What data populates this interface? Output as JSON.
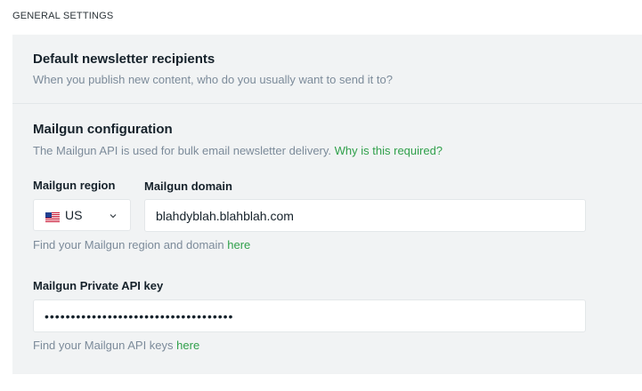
{
  "section": {
    "title": "GENERAL SETTINGS"
  },
  "newsletter": {
    "title": "Default newsletter recipients",
    "description": "When you publish new content, who do you usually want to send it to?"
  },
  "mailgun": {
    "title": "Mailgun configuration",
    "description": "The Mailgun API is used for bulk email newsletter delivery.",
    "why_link": "Why is this required?",
    "region": {
      "label": "Mailgun region",
      "value": "US",
      "flag_icon": "us-flag-icon"
    },
    "domain": {
      "label": "Mailgun domain",
      "value": "blahdyblah.blahblah.com"
    },
    "domain_hint": {
      "text": "Find your Mailgun region and domain",
      "link": "here"
    },
    "api_key": {
      "label": "Mailgun Private API key",
      "value": "••••••••••••••••••••••••••••••••••••"
    },
    "api_hint": {
      "text": "Find your Mailgun API keys",
      "link": "here"
    }
  },
  "colors": {
    "link": "#30a04b",
    "panel": "#f1f3f4",
    "muted": "#7c8b9a"
  }
}
